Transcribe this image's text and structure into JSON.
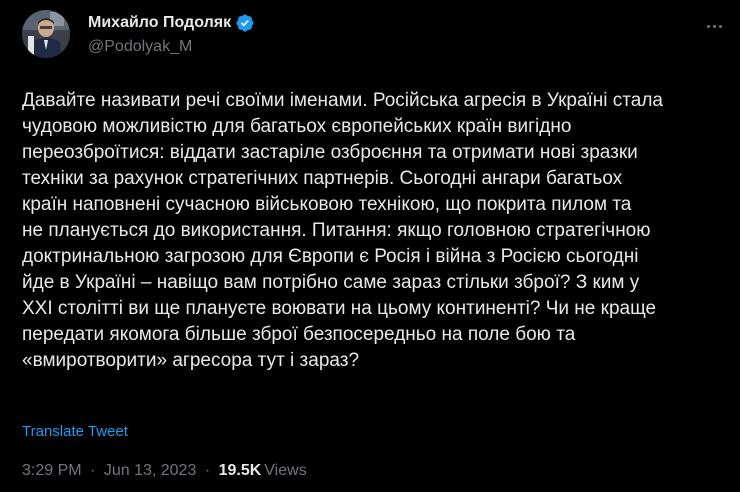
{
  "author": {
    "display_name": "Михайло Подоляк",
    "handle": "@Podolyak_M",
    "verified_color": "#1d9bf0"
  },
  "tweet": {
    "lines": [
      "Давайте називати речі своїми іменами. Російська агресія в Україні стала",
      "чудовою можливістю для багатьох європейських країн вигідно",
      "переозброїтися: віддати застаріле озброєння та отримати нові зразки",
      "техніки за рахунок стратегічних партнерів. Сьогодні ангари багатьох",
      "країн наповнені сучасною військовою технікою, що покрита пилом та",
      "не планується до використання. Питання: якщо головною стратегічною",
      "доктринальною загрозою для Європи є Росія і війна з Росією сьогодні",
      "йде в Україні – навіщо вам потрібно саме зараз стільки зброї? З ким у",
      "XXI столітті ви ще плануєте воювати на цьому континенті? Чи не краще",
      "передати якомога більше зброї безпосередньо на поле бою та",
      "«вмиротворити» агресора тут і зараз?"
    ],
    "translate_label": "Translate Tweet",
    "time": "3:29 PM",
    "date": "Jun 13, 2023",
    "separator": "·",
    "views_count": "19.5K",
    "views_label": "Views"
  },
  "icons": {
    "verified": "verified-badge-icon",
    "more": "more-options-icon"
  },
  "colors": {
    "background": "#000000",
    "text": "#e7e9ea",
    "secondary": "#71767b",
    "accent": "#1d9bf0"
  }
}
